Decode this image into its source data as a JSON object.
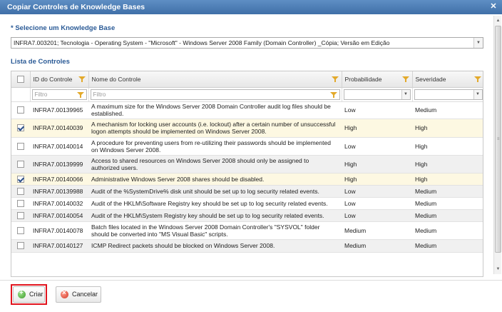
{
  "dialog": {
    "title": "Copiar Controles de Knowledge Bases"
  },
  "kb": {
    "label": "* Selecione um Knowledge Base",
    "selected": "INFRA7.003201; Tecnologia - Operating System - \"Microsoft\" - Windows Server 2008 Family (Domain Controller) _Cópia; Versão em Edição"
  },
  "list": {
    "label": "Lista de Controles",
    "columns": [
      "ID do Controle",
      "Nome do Controle",
      "Probabilidade",
      "Severidade"
    ],
    "filter_placeholder": "Filtro",
    "rows": [
      {
        "id": "INFRA7.00139965",
        "name": "A maximum size for the Windows Server 2008 Domain Controller audit log files should be established.",
        "prob": "Low",
        "sev": "Medium",
        "checked": false
      },
      {
        "id": "INFRA7.00140039",
        "name": "A mechanism for locking user accounts (i.e. lockout) after a certain number of unsuccessful logon attempts should be implemented on Windows Server 2008.",
        "prob": "High",
        "sev": "High",
        "checked": true
      },
      {
        "id": "INFRA7.00140014",
        "name": "A procedure for preventing users from re-utilizing their passwords should be implemented on Windows Server 2008.",
        "prob": "Low",
        "sev": "High",
        "checked": false
      },
      {
        "id": "INFRA7.00139999",
        "name": "Access to shared resources on Windows Server 2008 should only be assigned to authorized users.",
        "prob": "High",
        "sev": "High",
        "checked": false
      },
      {
        "id": "INFRA7.00140066",
        "name": "Administrative Windows Server 2008 shares should be disabled.",
        "prob": "High",
        "sev": "High",
        "checked": true
      },
      {
        "id": "INFRA7.00139988",
        "name": "Audit of the %SystemDrive% disk unit should be set up to log security related events.",
        "prob": "Low",
        "sev": "Medium",
        "checked": false
      },
      {
        "id": "INFRA7.00140032",
        "name": "Audit of the HKLM\\Software Registry key should be set up to log security related events.",
        "prob": "Low",
        "sev": "Medium",
        "checked": false
      },
      {
        "id": "INFRA7.00140054",
        "name": "Audit of the HKLM\\System Registry key should be set up to log security related events.",
        "prob": "Low",
        "sev": "Medium",
        "checked": false
      },
      {
        "id": "INFRA7.00140078",
        "name": "Batch files located in the Windows Server 2008 Domain Controller's \"SYSVOL\" folder should be converted into \"MS Visual Basic\" scripts.",
        "prob": "Medium",
        "sev": "Medium",
        "checked": false
      },
      {
        "id": "INFRA7.00140127",
        "name": "ICMP Redirect packets should be blocked on Windows Server 2008.",
        "prob": "Medium",
        "sev": "Medium",
        "checked": false
      }
    ]
  },
  "buttons": {
    "create": "Criar",
    "cancel": "Cancelar"
  },
  "colors": {
    "title_bar": "#4a7bb5",
    "label_blue": "#2a5a96",
    "selected_row": "#fdf8e2",
    "highlight_outline": "#e1141e"
  },
  "icons": [
    "close-icon",
    "filter-icon",
    "chevron-down-icon",
    "add-icon",
    "cancel-icon"
  ]
}
